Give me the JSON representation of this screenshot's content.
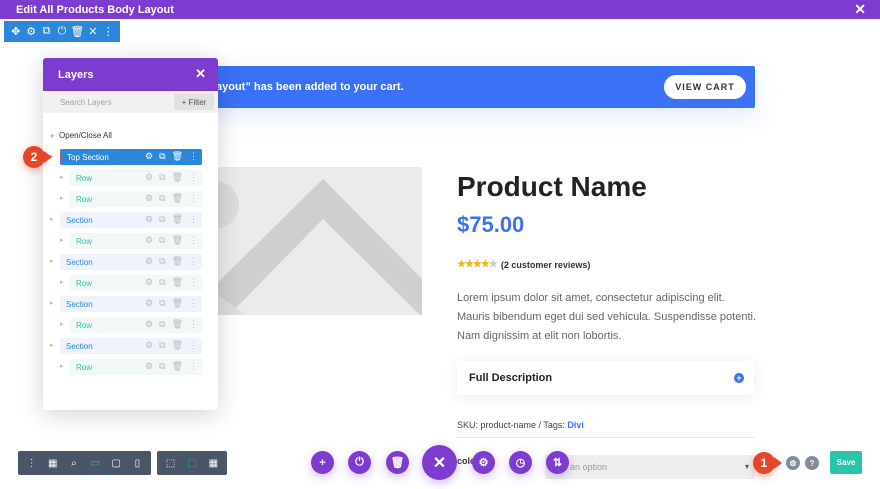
{
  "window": {
    "title": "Edit All Products Body Layout",
    "close_icon": "✕"
  },
  "row_toolbar": {
    "icons": [
      "move-icon",
      "gear-icon",
      "duplicate-icon",
      "power-icon",
      "trash-icon",
      "close-icon",
      "more-icon"
    ],
    "glyphs": [
      "✥",
      "⚙",
      "⧉",
      "⏻",
      "🗑",
      "✕",
      "⋮"
    ]
  },
  "notice": {
    "text": "ayout” has been added to your cart.",
    "button": "VIEW CART"
  },
  "product": {
    "name": "Product Name",
    "price": "$75.00",
    "stars_filled": "★★★★",
    "stars_empty": "★",
    "rating_value": 4,
    "rating_max": 5,
    "reviews": "(2 customer reviews)",
    "description": "Lorem ipsum dolor sit amet, consectetur adipiscing elit. Mauris bibendum eget dui sed vehicula. Suspendisse potenti. Nam dignissim at elit non lobortis.",
    "accordion_title": "Full Description",
    "accordion_icon": "+",
    "sku_text": "SKU: product-name / Tags: ",
    "sku_tag": "Divi",
    "color_label": "colo",
    "select_placeholder": "k an option",
    "select_arrow": "▾"
  },
  "layers": {
    "title": "Layers",
    "close": "✕",
    "search_placeholder": "Search Layers",
    "filter": "+ Filter",
    "open_close": "Open/Close All",
    "tri": "▸",
    "items": [
      {
        "label": "Top Section",
        "kind": "section",
        "active": true
      },
      {
        "label": "Row",
        "kind": "row"
      },
      {
        "label": "Row",
        "kind": "row"
      },
      {
        "label": "Section",
        "kind": "section"
      },
      {
        "label": "Row",
        "kind": "row"
      },
      {
        "label": "Section",
        "kind": "section"
      },
      {
        "label": "Row",
        "kind": "row"
      },
      {
        "label": "Section",
        "kind": "section"
      },
      {
        "label": "Row",
        "kind": "row"
      },
      {
        "label": "Section",
        "kind": "section"
      },
      {
        "label": "Row",
        "kind": "row"
      }
    ],
    "item_actions": [
      "⚙",
      "⧉",
      "🗑",
      "⋮"
    ]
  },
  "markers": {
    "m1": "1",
    "m2": "2"
  },
  "bottom": {
    "left_bar": [
      "⋮",
      "▦",
      "⌕",
      "▭",
      "▢",
      "▯"
    ],
    "left_bar_names": [
      "more-icon",
      "wireframe-icon",
      "zoom-icon",
      "desktop-icon",
      "tablet-icon",
      "phone-icon"
    ],
    "mid_bar": [
      "⬚",
      "⬚",
      "▦"
    ],
    "mid_bar_names": [
      "click-mode-icon",
      "hover-mode-icon",
      "grid-mode-icon"
    ],
    "circle_actions": [
      "+",
      "⏻",
      "🗑",
      "✕",
      "⚙",
      "◷",
      "⇅"
    ],
    "circle_names": [
      "add-icon",
      "power-icon",
      "trash-icon",
      "close-icon",
      "settings-icon",
      "history-icon",
      "portability-icon"
    ],
    "settings_small": "⚙",
    "help_small": "?",
    "save": "Save"
  }
}
